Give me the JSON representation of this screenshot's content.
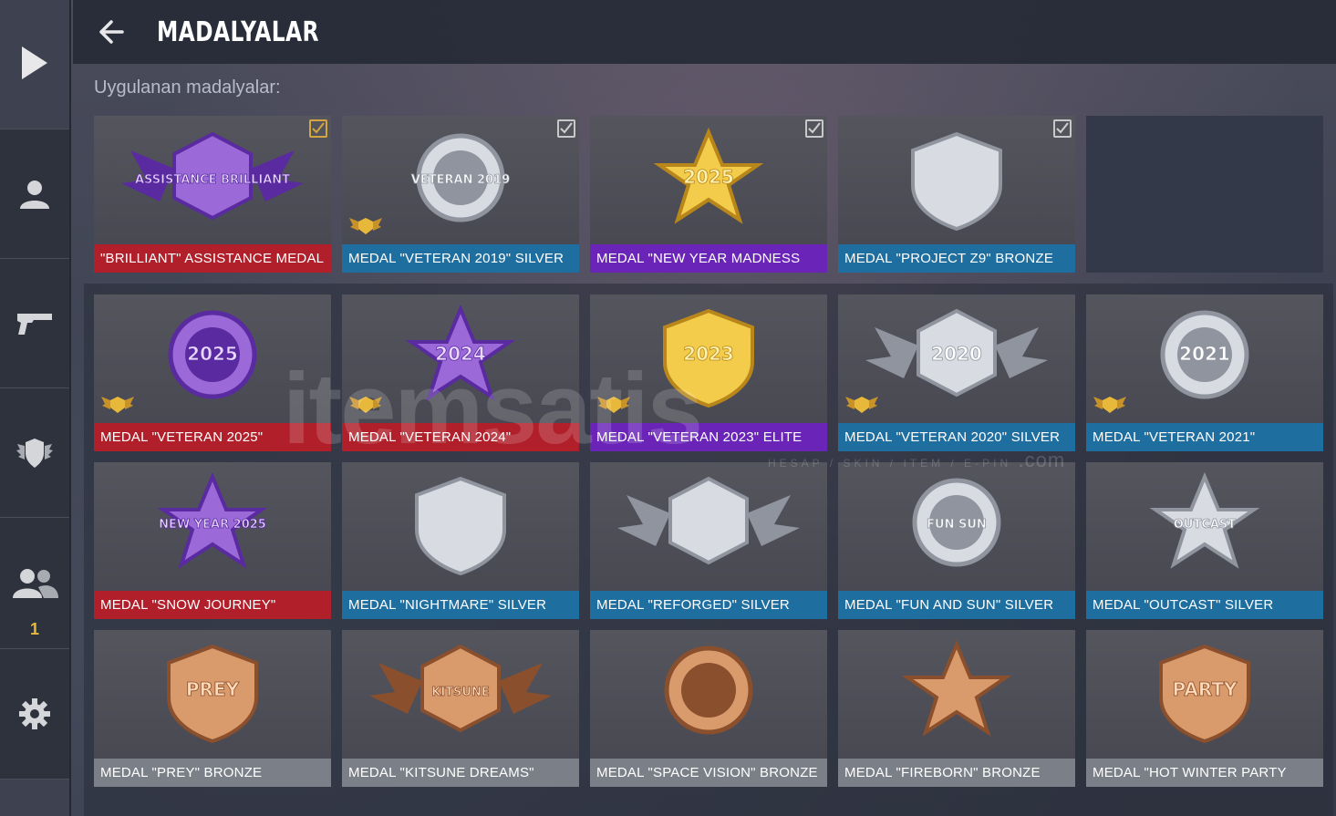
{
  "header": {
    "title": "MADALYALAR"
  },
  "section": {
    "applied_label": "Uygulanan madalyalar:"
  },
  "sidebar": {
    "friends_count": "1"
  },
  "watermark": {
    "main": "itemsatis",
    "sub": "HESAP / SKIN / ITEM / E-PIN",
    "domain": ".com"
  },
  "applied_medals": [
    {
      "name": "\"BRILLIANT\" ASSISTANCE MEDAL",
      "color": "red",
      "checked": true,
      "check_color": "gold",
      "medal_text": "ASSISTANCE BRILLIANT"
    },
    {
      "name": "MEDAL \"VETERAN 2019\" SILVER",
      "color": "blue",
      "checked": true,
      "medal_text": "VETERAN 2019"
    },
    {
      "name": "MEDAL \"NEW YEAR MADNESS",
      "color": "purple",
      "checked": true,
      "medal_text": "2025"
    },
    {
      "name": "MEDAL \"PROJECT Z9\" BRONZE",
      "color": "blue",
      "checked": true,
      "medal_text": ""
    }
  ],
  "medal_grid": [
    {
      "name": "MEDAL \"VETERAN 2025\"",
      "color": "red",
      "medal_text": "2025",
      "wing": true
    },
    {
      "name": "MEDAL \"VETERAN 2024\"",
      "color": "red",
      "medal_text": "2024",
      "wing": true
    },
    {
      "name": "MEDAL \"VETERAN 2023\" ELITE",
      "color": "purple",
      "medal_text": "2023",
      "wing": true
    },
    {
      "name": "MEDAL \"VETERAN 2020\" SILVER",
      "color": "blue",
      "medal_text": "2020",
      "wing": true
    },
    {
      "name": "MEDAL \"VETERAN 2021\"",
      "color": "blue",
      "medal_text": "2021",
      "wing": true
    },
    {
      "name": "MEDAL \"SNOW JOURNEY\"",
      "color": "red",
      "medal_text": "NEW YEAR 2025"
    },
    {
      "name": "MEDAL \"NIGHTMARE\" SILVER",
      "color": "blue",
      "medal_text": ""
    },
    {
      "name": "MEDAL \"REFORGED\" SILVER",
      "color": "blue",
      "medal_text": ""
    },
    {
      "name": "MEDAL \"FUN AND SUN\" SILVER",
      "color": "blue",
      "medal_text": "FUN SUN"
    },
    {
      "name": "MEDAL \"OUTCAST\" SILVER",
      "color": "blue",
      "medal_text": "OUTCAST"
    },
    {
      "name": "MEDAL \"PREY\" BRONZE",
      "color": "gray",
      "medal_text": "PREY"
    },
    {
      "name": "MEDAL \"KITSUNE DREAMS\"",
      "color": "gray",
      "medal_text": "KITSUNE"
    },
    {
      "name": "MEDAL \"SPACE VISION\" BRONZE",
      "color": "gray",
      "medal_text": ""
    },
    {
      "name": "MEDAL \"FIREBORN\" BRONZE",
      "color": "gray",
      "medal_text": ""
    },
    {
      "name": "MEDAL \"HOT WINTER PARTY",
      "color": "gray",
      "medal_text": "PARTY"
    }
  ],
  "colors": {
    "red": "#b01f2a",
    "blue": "#1f6ea0",
    "purple": "#6a24b8",
    "gray": "#7a7f88",
    "gold": "#e8b83a"
  }
}
